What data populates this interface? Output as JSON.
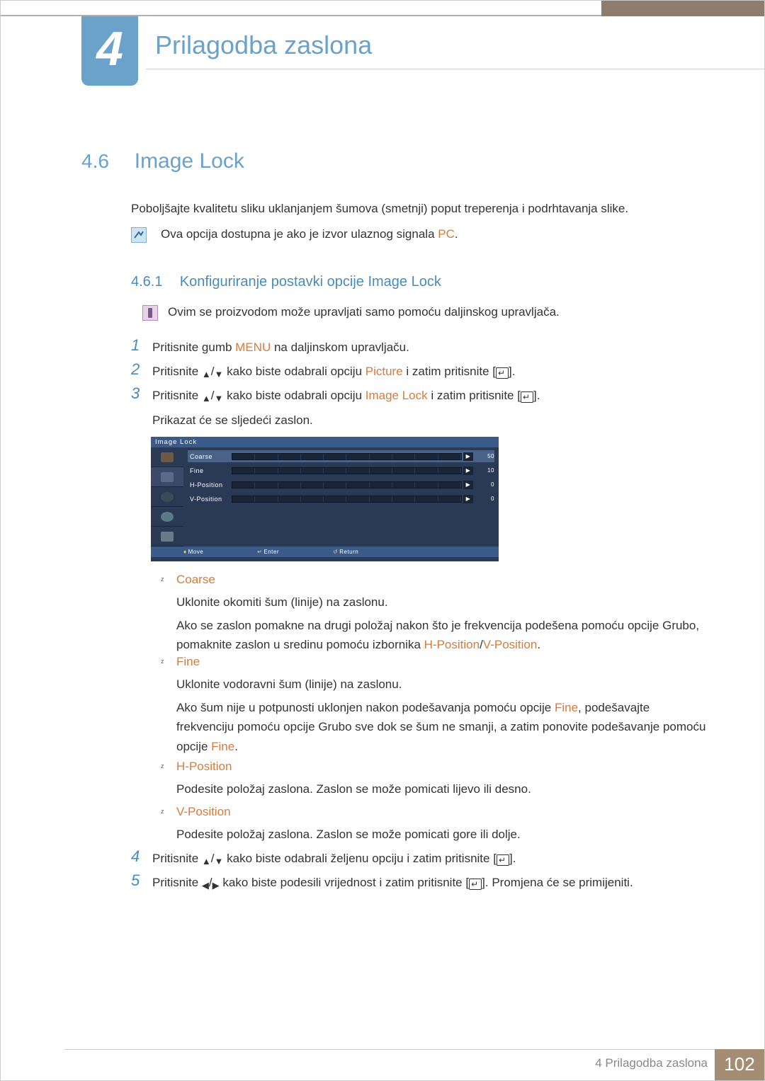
{
  "chapter": {
    "number": "4",
    "title": "Prilagodba zaslona"
  },
  "section": {
    "number": "4.6",
    "title": "Image Lock"
  },
  "intro": "Poboljšajte kvalitetu sliku uklanjanjem šumova (smetnji) poput treperenja i podrhtavanja slike.",
  "note1_pre": "Ova opcija dostupna je ako je izvor ulaznog signala ",
  "note1_hl": "PC",
  "note1_post": ".",
  "subsection": {
    "number": "4.6.1",
    "title": "Konfiguriranje postavki opcije Image Lock"
  },
  "note2": "Ovim se proizvodom može upravljati samo pomoću daljinskog upravljača.",
  "steps": {
    "s1": {
      "num": "1",
      "pre": "Pritisnite gumb ",
      "hl": "MENU",
      "post": " na daljinskom upravljaču."
    },
    "s2": {
      "num": "2",
      "pre": "Pritisnite ",
      "mid": " kako biste odabrali opciju ",
      "hl": "Picture",
      "post": " i zatim pritisnite [",
      "tail": "]."
    },
    "s3": {
      "num": "3",
      "pre": "Pritisnite ",
      "mid": " kako biste odabrali opciju ",
      "hl": "Image Lock",
      "post": " i zatim pritisnite [",
      "tail": "].",
      "line2": "Prikazat će se sljedeći zaslon."
    },
    "s4": {
      "num": "4",
      "pre": "Pritisnite ",
      "mid": " kako biste odabrali željenu opciju i zatim pritisnite [",
      "tail": "]."
    },
    "s5": {
      "num": "5",
      "pre": "Pritisnite ",
      "mid": " kako biste podesili vrijednost i zatim pritisnite [",
      "tail": "]. Promjena će se primijeniti."
    }
  },
  "osd": {
    "title": "Image Lock",
    "rows": [
      {
        "label": "Coarse",
        "val": "50",
        "sel": true
      },
      {
        "label": "Fine",
        "val": "10",
        "sel": false
      },
      {
        "label": "H-Position",
        "val": "0",
        "sel": false
      },
      {
        "label": "V-Position",
        "val": "0",
        "sel": false
      }
    ],
    "footer": {
      "move": "Move",
      "enter": "Enter",
      "return": "Return"
    }
  },
  "bullets": {
    "coarse": {
      "title": "Coarse",
      "p1": "Uklonite okomiti šum (linije) na zaslonu.",
      "p2a": "Ako se zaslon pomakne na drugi položaj nakon što je frekvencija podešena pomoću opcije Grubo, pomaknite zaslon u sredinu pomoću izbornika ",
      "p2h1": "H-Position",
      "p2sep": "/",
      "p2h2": "V-Position",
      "p2b": "."
    },
    "fine": {
      "title": "Fine",
      "p1": "Uklonite vodoravni šum (linije) na zaslonu.",
      "p2a": "Ako šum nije u potpunosti uklonjen nakon podešavanja pomoću opcije ",
      "p2h1": "Fine",
      "p2b": ", podešavajte frekvenciju pomoću opcije Grubo sve dok se šum ne smanji, a zatim ponovite podešavanje pomoću opcije ",
      "p2h2": "Fine",
      "p2c": "."
    },
    "hpos": {
      "title": "H-Position",
      "p1": "Podesite položaj zaslona. Zaslon se može pomicati lijevo ili desno."
    },
    "vpos": {
      "title": "V-Position",
      "p1": "Podesite položaj zaslona. Zaslon se može pomicati gore ili dolje."
    }
  },
  "footer": {
    "label_prefix": "4 ",
    "label": "Prilagodba zaslona",
    "page": "102"
  }
}
